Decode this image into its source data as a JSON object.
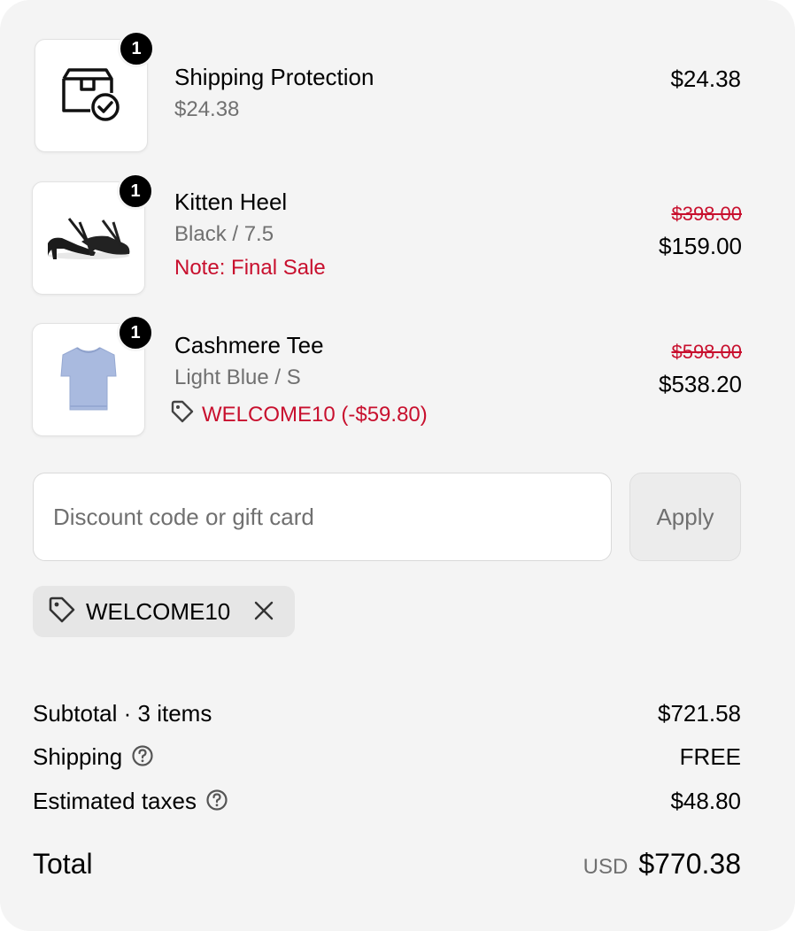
{
  "line_items": [
    {
      "quantity": "1",
      "title": "Shipping Protection",
      "subtitle": "$24.38",
      "price": "$24.38",
      "icon": "package-check-icon"
    },
    {
      "quantity": "1",
      "title": "Kitten Heel",
      "subtitle": "Black / 7.5",
      "note": "Note: Final Sale",
      "original_price": "$398.00",
      "price": "$159.00",
      "image": "black-heel-sandal"
    },
    {
      "quantity": "1",
      "title": "Cashmere Tee",
      "subtitle": "Light Blue / S",
      "discount_text": "WELCOME10 (-$59.80)",
      "original_price": "$598.00",
      "price": "$538.20",
      "image": "light-blue-tee"
    }
  ],
  "discount": {
    "placeholder": "Discount code or gift card",
    "value": "",
    "apply_label": "Apply",
    "applied_code": "WELCOME10"
  },
  "summary": {
    "subtotal_label": "Subtotal · 3 items",
    "subtotal_value": "$721.58",
    "shipping_label": "Shipping",
    "shipping_value": "FREE",
    "taxes_label": "Estimated taxes",
    "taxes_value": "$48.80",
    "total_label": "Total",
    "total_currency": "USD",
    "total_value": "$770.38"
  },
  "colors": {
    "panel_bg": "#f4f4f4",
    "sale_red": "#c8102e",
    "muted_text": "#707070",
    "badge_bg": "#000000"
  }
}
